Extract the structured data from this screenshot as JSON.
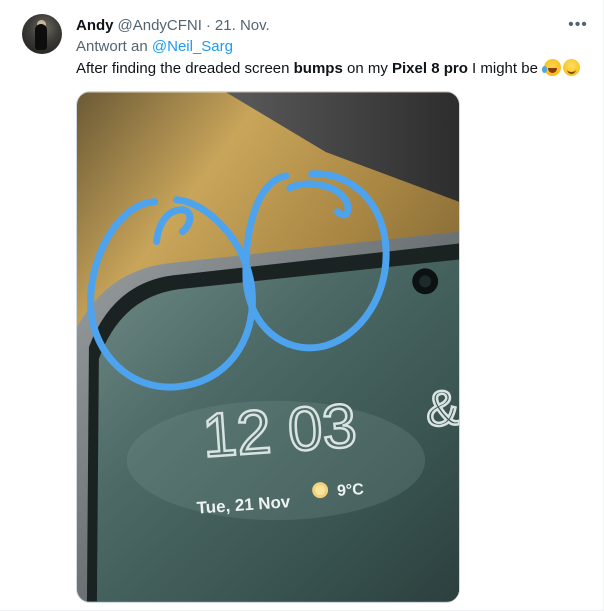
{
  "tweet": {
    "author_name": "Andy",
    "author_handle": "@AndyCFNI",
    "separator": "·",
    "date": "21. Nov.",
    "reply_prefix": "Antwort an",
    "reply_mention": "@Neil_Sarg",
    "text_1": "After finding the dreaded screen ",
    "text_bold_1": "bumps",
    "text_2": " on my ",
    "text_bold_2": "Pixel 8 pro",
    "text_3": " I might be ",
    "emojis": [
      "face-with-tears-of-joy-emoji",
      "melting-face-emoji"
    ],
    "more_icon": "ellipsis-icon"
  },
  "media": {
    "clock_time": "12 03",
    "date_line": "Tue, 21 Nov",
    "weather_temp": "9°C",
    "annotation_color": "#4da3ee"
  }
}
